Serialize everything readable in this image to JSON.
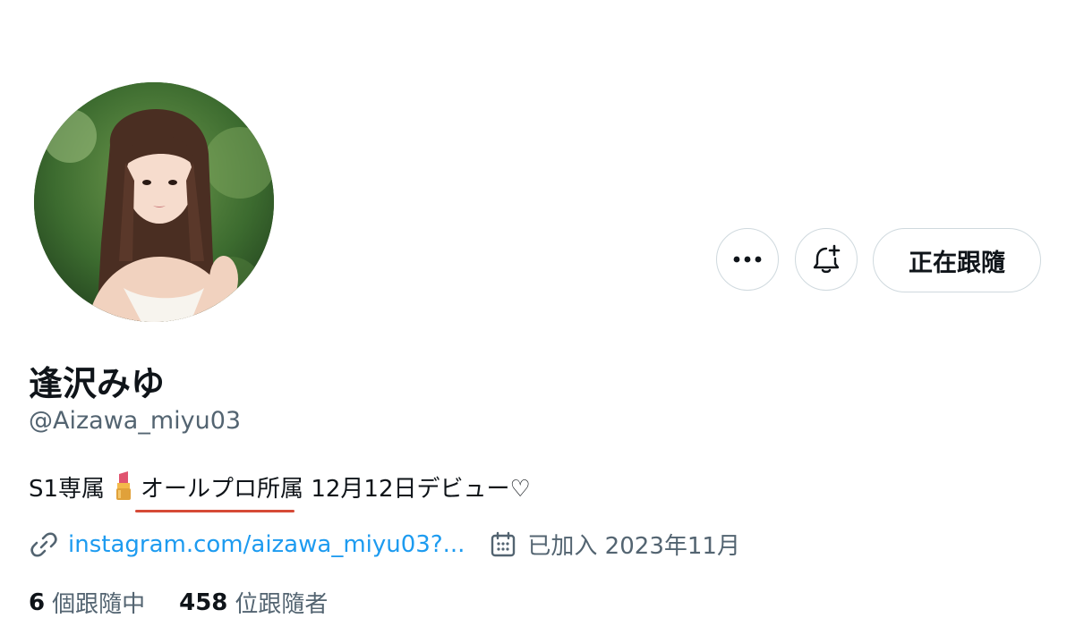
{
  "profile": {
    "display_name": "逢沢みゆ",
    "handle": "@Aizawa_miyu03",
    "bio": {
      "prefix": "S1専属",
      "emoji": "lipstick-emoji",
      "agency": "オールプロ所属",
      "debut": " 12月12日デビュー♡"
    },
    "link": "instagram.com/aizawa_miyu03?...",
    "joined": "已加入 2023年11月"
  },
  "actions": {
    "more_icon": "more-dots-icon",
    "notify_icon": "bell-plus-icon",
    "follow_label": "正在跟隨"
  },
  "stats": {
    "following_count": "6",
    "following_label": "個跟隨中",
    "followers_count": "458",
    "followers_label": "位跟隨者"
  },
  "colors": {
    "accent_link": "#1d9bf0",
    "secondary_text": "#536471",
    "underline_mark": "#d64a37",
    "border": "#cfd9de"
  }
}
